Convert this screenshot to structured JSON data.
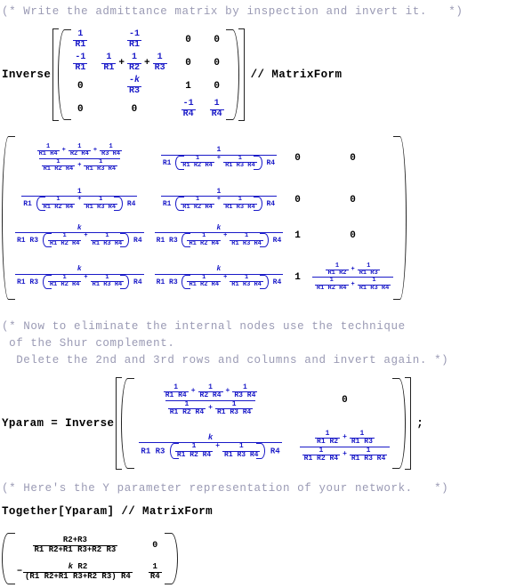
{
  "notebook": {
    "app": "Mathematica Notebook",
    "symbols": {
      "R1": "R1",
      "R2": "R2",
      "R3": "R3",
      "R4": "R4",
      "k": "k",
      "one": "1",
      "zero": "0",
      "minus_one": "-1",
      "minus_k": "-k"
    },
    "cells": [
      {
        "type": "comment",
        "name": "comment-write-admittance",
        "lines": [
          "(* Write the admittance matrix by inspection and invert it.   *)"
        ]
      },
      {
        "type": "input",
        "name": "input-inverse-matrixform",
        "prefix": "Inverse",
        "suffix": "// MatrixForm",
        "matrix": {
          "rows": 4,
          "cols": 4,
          "cells": [
            [
              "1/R1",
              "-1/R1",
              "0",
              "0"
            ],
            [
              "-1/R1",
              "1/R1 + 1/R2 + 1/R3",
              "0",
              "0"
            ],
            [
              "0",
              "-k/R3",
              "1",
              "0"
            ],
            [
              "0",
              "0",
              "-1/R4",
              "1/R4"
            ]
          ]
        }
      },
      {
        "type": "output",
        "name": "output-inverted-matrix",
        "matrix": {
          "rows": 4,
          "cols": 4,
          "cells": [
            [
              "(1/(R1 R4) + 1/(R2 R4) + 1/(R3 R4)) / (1/(R1 R2 R4) + 1/(R1 R3 R4))",
              "1 / (R1 (1/(R1 R2 R4) + 1/(R1 R3 R4)) R4)",
              "0",
              "0"
            ],
            [
              "1 / (R1 (1/(R1 R2 R4) + 1/(R1 R3 R4)) R4)",
              "1 / (R1 (1/(R1 R2 R4) + 1/(R1 R3 R4)) R4)",
              "0",
              "0"
            ],
            [
              "k / (R1 R3 (1/(R1 R2 R4) + 1/(R1 R3 R4)) R4)",
              "k / (R1 R3 (1/(R1 R2 R4) + 1/(R1 R3 R4)) R4)",
              "1",
              "0"
            ],
            [
              "k / (R1 R3 (1/(R1 R2 R4) + 1/(R1 R3 R4)) R4)",
              "k / (R1 R3 (1/(R1 R2 R4) + 1/(R1 R3 R4)) R4)",
              "1",
              "(1/(R1 R2) + 1/(R1 R3)) / (1/(R1 R2 R4) + 1/(R1 R3 R4))"
            ]
          ]
        }
      },
      {
        "type": "comment",
        "name": "comment-shur-complement",
        "lines": [
          "(* Now to eliminate the internal nodes use the technique",
          " of the Shur complement.",
          "  Delete the 2nd and 3rd rows and columns and invert again. *)"
        ]
      },
      {
        "type": "input",
        "name": "input-yparam-inverse",
        "prefix": "Yparam = Inverse",
        "suffix": ";",
        "matrix": {
          "rows": 2,
          "cols": 2,
          "cells": [
            [
              "(1/(R1 R4) + 1/(R2 R4) + 1/(R3 R4)) / (1/(R1 R2 R4) + 1/(R1 R3 R4))",
              "0"
            ],
            [
              "k / (R1 R3 (1/(R1 R2 R4) + 1/(R1 R3 R4)) R4)",
              "(1/(R1 R2) + 1/(R1 R3)) / (1/(R1 R2 R4) + 1/(R1 R3 R4))"
            ]
          ]
        }
      },
      {
        "type": "comment",
        "name": "comment-y-parameter-representation",
        "lines": [
          "(* Here's the Y parameter representation of your network.   *)"
        ]
      },
      {
        "type": "input",
        "name": "input-together-yparam",
        "text": "Together[Yparam] // MatrixForm"
      },
      {
        "type": "output",
        "name": "output-y-matrix",
        "matrix": {
          "rows": 2,
          "cols": 2,
          "cells": [
            [
              "(R2+R3)/(R1 R2+R1 R3+R2 R3)",
              "0"
            ],
            [
              "-(k R2)/((R1 R2+R1 R3+R2 R3) R4)",
              "1/R4"
            ]
          ]
        }
      }
    ],
    "text": {
      "comment1": "(* Write the admittance matrix by inspection and invert it.   *)",
      "comment2_l1": "(* Now to eliminate the internal nodes use the technique",
      "comment2_l2": " of the Shur complement.",
      "comment2_l3": "  Delete the 2nd and 3rd rows and columns and invert again. *)",
      "comment3": "(* Here's the Y parameter representation of your network.   *)",
      "inverse": "Inverse",
      "matrixform": "// MatrixForm",
      "yparam_inverse": "Yparam = Inverse",
      "semicolon": ";",
      "together": "Together[Yparam] // MatrixForm",
      "bracket_open": "[",
      "bracket_close": "]"
    },
    "colors": {
      "comment": "#9a9ab4",
      "code": "#000000",
      "symbol_blue": "#1a1ac8",
      "background": "#ffffff"
    }
  }
}
